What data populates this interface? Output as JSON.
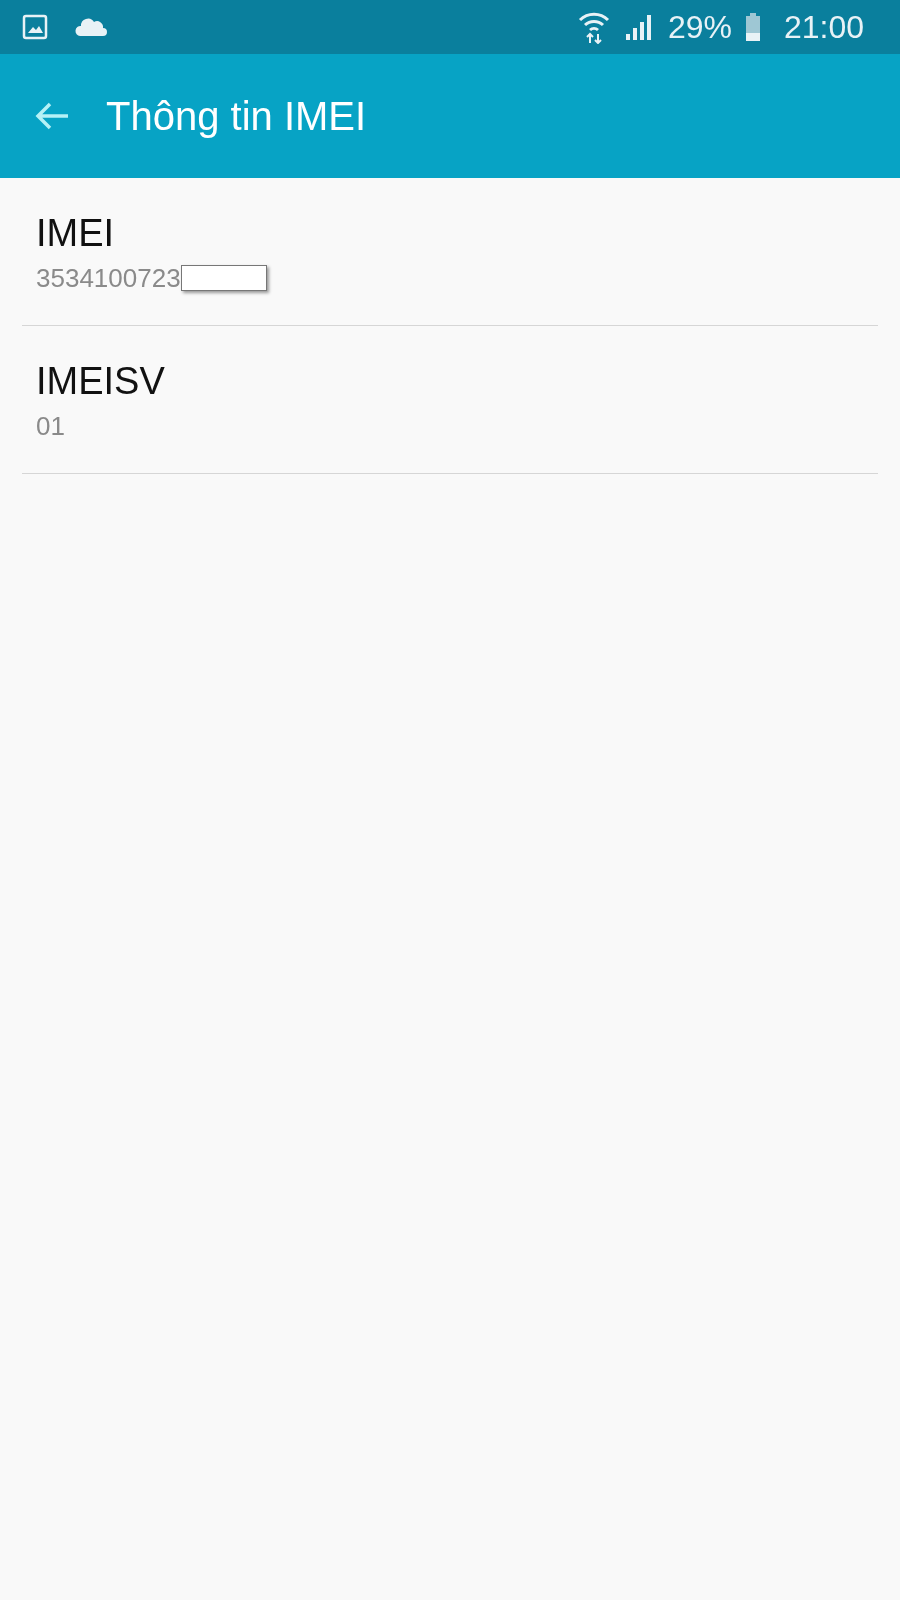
{
  "status_bar": {
    "battery": "29%",
    "time": "21:00"
  },
  "app_bar": {
    "title": "Thông tin IMEI"
  },
  "items": [
    {
      "title": "IMEI",
      "value": "3534100723",
      "redacted": true
    },
    {
      "title": "IMEISV",
      "value": "01",
      "redacted": false
    }
  ]
}
